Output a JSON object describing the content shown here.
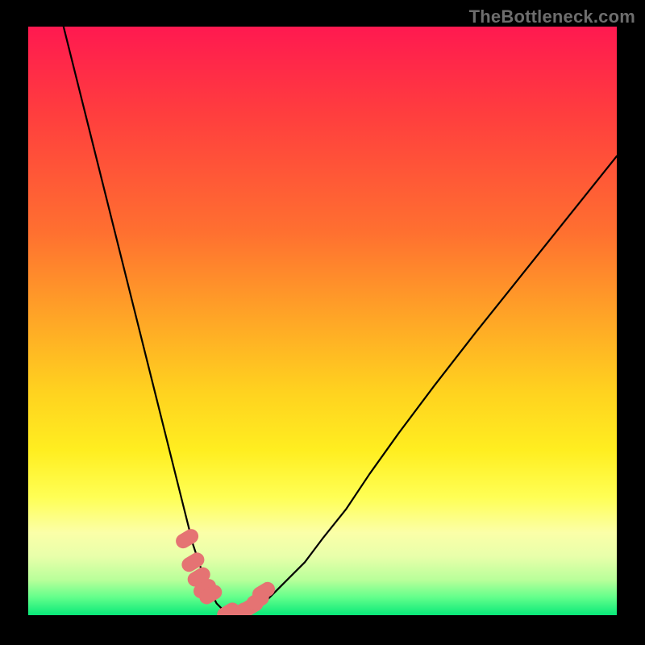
{
  "watermark": "TheBottleneck.com",
  "chart_data": {
    "type": "line",
    "title": "",
    "xlabel": "",
    "ylabel": "",
    "xlim": [
      0,
      100
    ],
    "ylim": [
      0,
      100
    ],
    "grid": false,
    "series": [
      {
        "name": "bottleneck-curve",
        "color": "#000000",
        "x": [
          6,
          8,
          10,
          12,
          14,
          16,
          18,
          20,
          22,
          24,
          26,
          27,
          28,
          29,
          30,
          31,
          32,
          33,
          34,
          36,
          38,
          40,
          42,
          44,
          47,
          50,
          54,
          58,
          63,
          69,
          76,
          84,
          92,
          100
        ],
        "y": [
          100,
          92,
          84,
          76,
          68,
          60,
          52,
          44,
          36,
          28,
          20,
          16,
          12,
          9,
          6,
          4,
          2,
          1,
          0,
          0,
          1,
          2,
          4,
          6,
          9,
          13,
          18,
          24,
          31,
          39,
          48,
          58,
          68,
          78
        ]
      },
      {
        "name": "marker-cluster",
        "color": "#e57373",
        "type": "scatter",
        "x": [
          27,
          28,
          29,
          30,
          31,
          34,
          36,
          37,
          38,
          39,
          40
        ],
        "y": [
          13,
          9,
          6.5,
          4.5,
          3.5,
          0.5,
          0.5,
          1,
          1.5,
          2.5,
          4
        ]
      }
    ]
  },
  "colors": {
    "gradient_top": "#ff1950",
    "gradient_mid": "#ffee20",
    "gradient_bottom": "#09e879",
    "curve": "#000000",
    "markers": "#e57373",
    "frame": "#000000"
  }
}
